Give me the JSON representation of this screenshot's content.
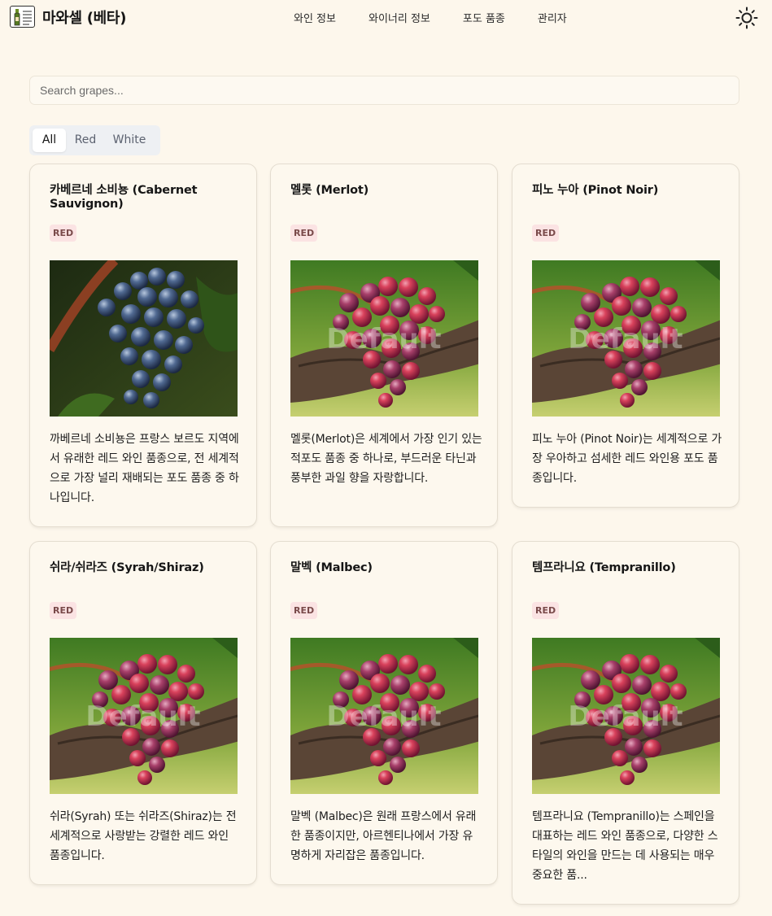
{
  "app": {
    "title": "마와셀 (베타)",
    "logo_icon": "wine-bottle-icon"
  },
  "nav": {
    "items": [
      "와인 정보",
      "와이너리 정보",
      "포도 품종",
      "관리자"
    ]
  },
  "theme_toggle": {
    "icon": "sun-icon"
  },
  "search": {
    "placeholder": "Search grapes...",
    "value": ""
  },
  "filters": {
    "tabs": [
      "All",
      "Red",
      "White"
    ],
    "active": "All"
  },
  "colors": {
    "background": "#fdf7ec",
    "badge_bg": "#fbe3e3",
    "badge_text": "#7a4a4a"
  },
  "grapes": [
    {
      "name": "카베르네 소비뇽 (Cabernet Sauvignon)",
      "type": "RED",
      "image": "dark-blue-grape-cluster",
      "description": "까베르네 소비뇽은 프랑스 보르도 지역에서 유래한 레드 와인 품종으로, 전 세계적으로 가장 널리 재배되는 포도 품종 중 하나입니다."
    },
    {
      "name": "멜롯 (Merlot)",
      "type": "RED",
      "image": "default-red-grape-cluster",
      "description": "멜롯(Merlot)은 세계에서 가장 인기 있는 적포도 품종 중 하나로, 부드러운 타닌과 풍부한 과일 향을 자랑합니다."
    },
    {
      "name": "피노 누아 (Pinot Noir)",
      "type": "RED",
      "image": "default-red-grape-cluster",
      "description": "피노 누아 (Pinot Noir)는 세계적으로 가장 우아하고 섬세한 레드 와인용 포도 품종입니다."
    },
    {
      "name": "쉬라/쉬라즈 (Syrah/Shiraz)",
      "type": "RED",
      "image": "default-red-grape-cluster",
      "description": "쉬라(Syrah) 또는 쉬라즈(Shiraz)는 전 세계적으로 사랑받는 강렬한 레드 와인 품종입니다."
    },
    {
      "name": "말벡 (Malbec)",
      "type": "RED",
      "image": "default-red-grape-cluster",
      "description": "말벡 (Malbec)은 원래 프랑스에서 유래한 품종이지만, 아르헨티나에서 가장 유명하게 자리잡은 품종입니다."
    },
    {
      "name": "템프라니요 (Tempranillo)",
      "type": "RED",
      "image": "default-red-grape-cluster",
      "description": "템프라니요 (Tempranillo)는 스페인을 대표하는 레드 와인 품종으로, 다양한 스타일의 와인을 만드는 데 사용되는 매우 중요한 품..."
    }
  ],
  "image_watermark": "Default"
}
